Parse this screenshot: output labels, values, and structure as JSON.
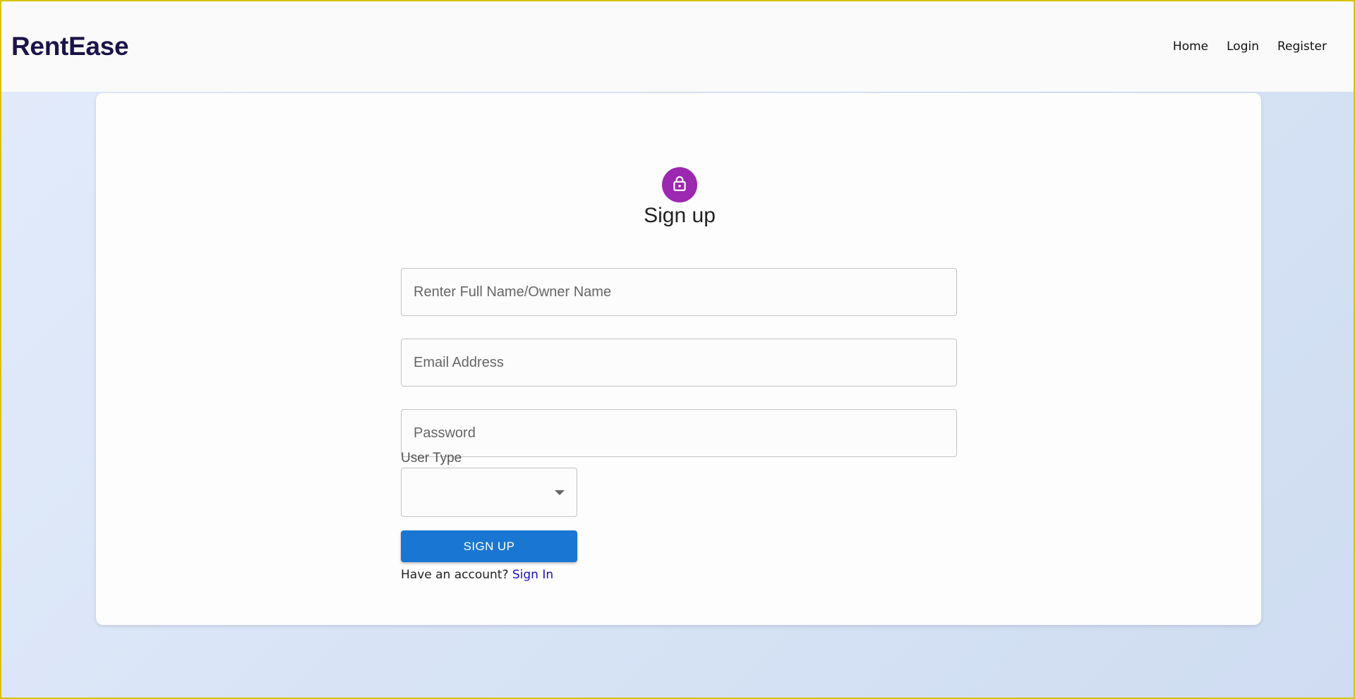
{
  "navbar": {
    "brand": "RentEase",
    "links": [
      {
        "label": "Home"
      },
      {
        "label": "Login"
      },
      {
        "label": "Register"
      }
    ]
  },
  "form": {
    "icon": "lock-icon",
    "title": "Sign up",
    "fields": {
      "name": {
        "placeholder": "Renter Full Name/Owner Name",
        "value": ""
      },
      "email": {
        "placeholder": "Email Address",
        "value": ""
      },
      "password": {
        "placeholder": "Password",
        "value": ""
      }
    },
    "user_type": {
      "label": "User Type",
      "selected": ""
    },
    "submit_label": "SIGN UP",
    "account_prompt": "Have an account?",
    "signin_label": "Sign In"
  },
  "colors": {
    "brand": "#1b1448",
    "avatar": "#9c27b0",
    "primary_button": "#1976d2",
    "link": "#1a0dcc"
  }
}
